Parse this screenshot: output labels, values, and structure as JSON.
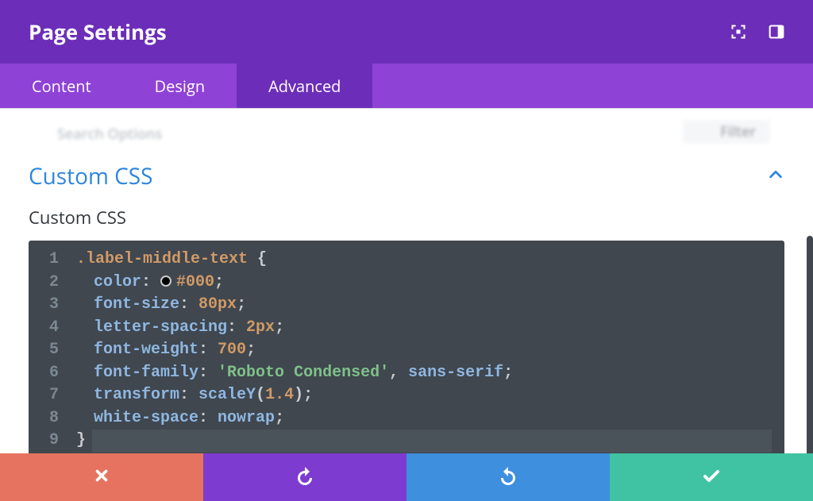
{
  "header": {
    "title": "Page Settings"
  },
  "tabs": {
    "content": "Content",
    "design": "Design",
    "advanced": "Advanced",
    "active": "advanced"
  },
  "options_row": {
    "left_label": "Search Options",
    "right_label": "Filter"
  },
  "section": {
    "title": "Custom CSS",
    "expanded": true,
    "field_label": "Custom CSS"
  },
  "code": {
    "lines": [
      {
        "n": "1",
        "tokens": [
          {
            "t": ".label-middle-text ",
            "c": "tk-sel"
          },
          {
            "t": "{",
            "c": "tk-punc"
          }
        ]
      },
      {
        "n": "2",
        "indent": true,
        "tokens": [
          {
            "t": "color",
            "c": "tk-prop"
          },
          {
            "t": ": ",
            "c": "tk-punc"
          },
          {
            "swatch": true
          },
          {
            "t": "#000",
            "c": "tk-val"
          },
          {
            "t": ";",
            "c": "tk-punc"
          }
        ]
      },
      {
        "n": "3",
        "indent": true,
        "tokens": [
          {
            "t": "font-size",
            "c": "tk-prop"
          },
          {
            "t": ": ",
            "c": "tk-punc"
          },
          {
            "t": "80px",
            "c": "tk-num"
          },
          {
            "t": ";",
            "c": "tk-punc"
          }
        ]
      },
      {
        "n": "4",
        "indent": true,
        "tokens": [
          {
            "t": "letter-spacing",
            "c": "tk-prop"
          },
          {
            "t": ": ",
            "c": "tk-punc"
          },
          {
            "t": "2px",
            "c": "tk-num"
          },
          {
            "t": ";",
            "c": "tk-punc"
          }
        ]
      },
      {
        "n": "5",
        "indent": true,
        "tokens": [
          {
            "t": "font-weight",
            "c": "tk-prop"
          },
          {
            "t": ": ",
            "c": "tk-punc"
          },
          {
            "t": "700",
            "c": "tk-num"
          },
          {
            "t": ";",
            "c": "tk-punc"
          }
        ]
      },
      {
        "n": "6",
        "indent": true,
        "tokens": [
          {
            "t": "font-family",
            "c": "tk-prop"
          },
          {
            "t": ": ",
            "c": "tk-punc"
          },
          {
            "t": "'Roboto Condensed'",
            "c": "tk-str"
          },
          {
            "t": ", ",
            "c": "tk-punc"
          },
          {
            "t": "sans-serif",
            "c": "tk-kw"
          },
          {
            "t": ";",
            "c": "tk-punc"
          }
        ]
      },
      {
        "n": "7",
        "indent": true,
        "tokens": [
          {
            "t": "transform",
            "c": "tk-prop"
          },
          {
            "t": ": ",
            "c": "tk-punc"
          },
          {
            "t": "scaleY",
            "c": "tk-fn"
          },
          {
            "t": "(",
            "c": "tk-punc"
          },
          {
            "t": "1.4",
            "c": "tk-num"
          },
          {
            "t": ")",
            "c": "tk-punc"
          },
          {
            "t": ";",
            "c": "tk-punc"
          }
        ]
      },
      {
        "n": "8",
        "indent": true,
        "tokens": [
          {
            "t": "white-space",
            "c": "tk-prop"
          },
          {
            "t": ": ",
            "c": "tk-punc"
          },
          {
            "t": "nowrap",
            "c": "tk-kw"
          },
          {
            "t": ";",
            "c": "tk-punc"
          }
        ]
      },
      {
        "n": "9",
        "hl": true,
        "tokens": [
          {
            "t": "}",
            "c": "tk-punc"
          }
        ]
      }
    ]
  },
  "footer": {
    "cancel": "cancel",
    "undo": "undo",
    "redo": "redo",
    "save": "save"
  }
}
